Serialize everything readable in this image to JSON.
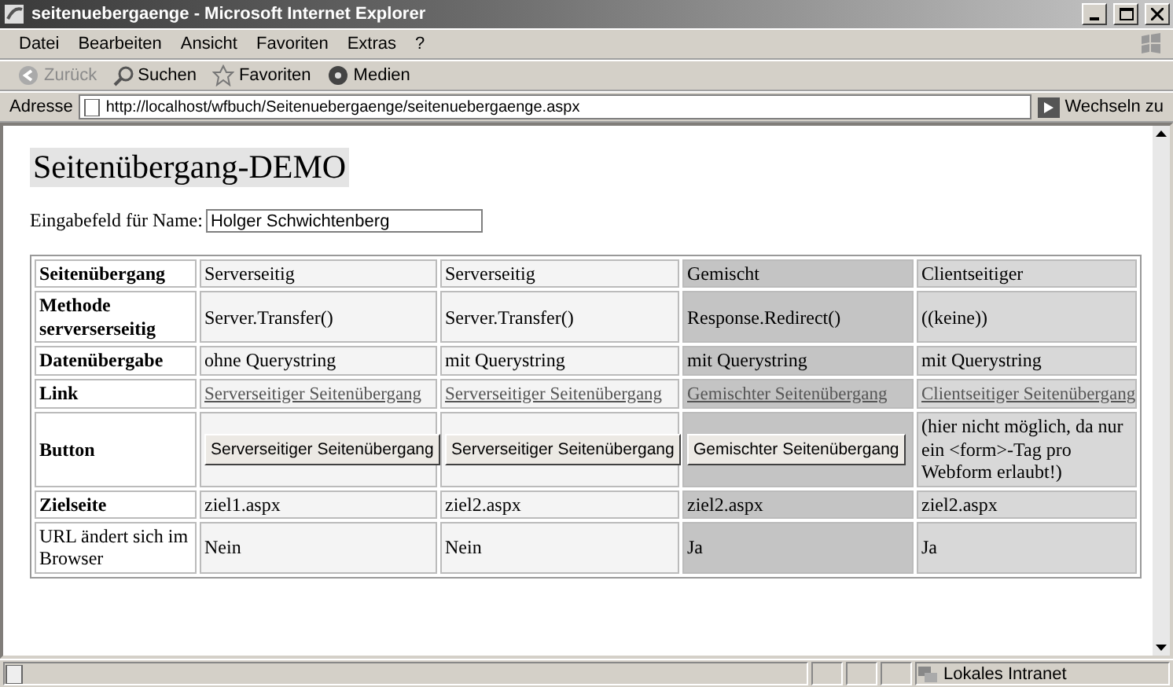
{
  "window": {
    "title": "seitenuebergaenge - Microsoft Internet Explorer"
  },
  "menu": [
    "Datei",
    "Bearbeiten",
    "Ansicht",
    "Favoriten",
    "Extras",
    "?"
  ],
  "toolbar": [
    {
      "kind": "back",
      "label": "Zurück",
      "disabled": true
    },
    {
      "kind": "search",
      "label": "Suchen",
      "disabled": false
    },
    {
      "kind": "favorites",
      "label": "Favoriten",
      "disabled": false
    },
    {
      "kind": "media",
      "label": "Medien",
      "disabled": false
    }
  ],
  "address": {
    "label": "Adresse",
    "url": "http://localhost/wfbuch/Seitenuebergaenge/seitenuebergaenge.aspx",
    "go": "Wechseln zu"
  },
  "page": {
    "heading": "Seitenübergang-DEMO",
    "name_field": {
      "label": "Eingabefeld für Name:",
      "value": "Holger Schwichtenberg"
    },
    "table": {
      "columns": [
        {
          "color": "#f4f4f4"
        },
        {
          "color": "#f4f4f4"
        },
        {
          "color": "#c4c4c4"
        },
        {
          "color": "#d8d8d8"
        }
      ],
      "rows": [
        {
          "label": "Seitenübergang",
          "bold": true,
          "cells": [
            {
              "kind": "text",
              "text": "Serverseitig"
            },
            {
              "kind": "text",
              "text": "Serverseitig"
            },
            {
              "kind": "text",
              "text": "Gemischt"
            },
            {
              "kind": "text",
              "text": "Clientseitiger"
            }
          ]
        },
        {
          "label": "Methode serverserseitig",
          "bold": true,
          "cells": [
            {
              "kind": "text",
              "text": "Server.Transfer()"
            },
            {
              "kind": "text",
              "text": "Server.Transfer()"
            },
            {
              "kind": "text",
              "text": "Response.Redirect()"
            },
            {
              "kind": "text",
              "text": "((keine))"
            }
          ]
        },
        {
          "label": "Datenübergabe",
          "bold": true,
          "cells": [
            {
              "kind": "text",
              "text": "ohne Querystring"
            },
            {
              "kind": "text",
              "text": "mit Querystring"
            },
            {
              "kind": "text",
              "text": "mit Querystring"
            },
            {
              "kind": "text",
              "text": "mit Querystring"
            }
          ]
        },
        {
          "label": "Link",
          "bold": true,
          "cells": [
            {
              "kind": "link",
              "text": "Serverseitiger Seitenübergang"
            },
            {
              "kind": "link",
              "text": "Serverseitiger Seitenübergang"
            },
            {
              "kind": "link",
              "text": "Gemischter Seitenübergang"
            },
            {
              "kind": "link",
              "text": "Clientseitiger Seitenübergang"
            }
          ]
        },
        {
          "label": "Button",
          "bold": true,
          "cells": [
            {
              "kind": "button",
              "text": "Serverseitiger Seitenübergang"
            },
            {
              "kind": "button",
              "text": "Serverseitiger Seitenübergang"
            },
            {
              "kind": "button",
              "text": "Gemischter Seitenübergang"
            },
            {
              "kind": "text",
              "text": "(hier nicht möglich, da nur ein <form>-Tag pro Webform erlaubt!)"
            }
          ]
        },
        {
          "label": "Zielseite",
          "bold": true,
          "cells": [
            {
              "kind": "text",
              "text": "ziel1.aspx"
            },
            {
              "kind": "text",
              "text": "ziel2.aspx"
            },
            {
              "kind": "text",
              "text": "ziel2.aspx"
            },
            {
              "kind": "text",
              "text": "ziel2.aspx"
            }
          ]
        },
        {
          "label": "URL ändert sich im Browser",
          "bold": false,
          "cells": [
            {
              "kind": "text",
              "text": "Nein"
            },
            {
              "kind": "text",
              "text": "Nein"
            },
            {
              "kind": "text",
              "text": "Ja"
            },
            {
              "kind": "text",
              "text": "Ja"
            }
          ]
        }
      ]
    }
  },
  "status_bar": {
    "zone": "Lokales Intranet"
  }
}
